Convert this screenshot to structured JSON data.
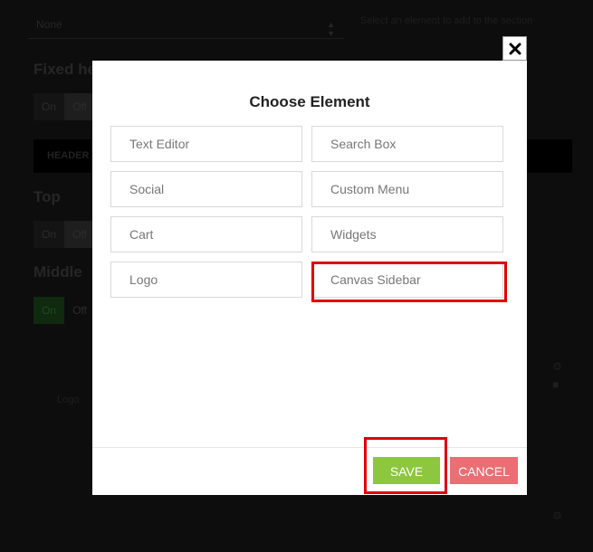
{
  "background": {
    "select_value": "None",
    "hint_text": "Select an element to add to the section",
    "headings": [
      "Fixed header",
      "Top",
      "Middle"
    ],
    "bar_label": "HEADER",
    "toggle_on": "On",
    "toggle_off": "Off",
    "faint_label": "Logo"
  },
  "modal": {
    "title": "Choose Element",
    "elements": [
      "Text Editor",
      "Search Box",
      "Social",
      "Custom Menu",
      "Cart",
      "Widgets",
      "Logo",
      "Canvas Sidebar"
    ],
    "save_label": "SAVE",
    "cancel_label": "CANCEL"
  },
  "colors": {
    "save": "#8dc63f",
    "cancel": "#ea6e73",
    "highlight": "#e00000"
  }
}
